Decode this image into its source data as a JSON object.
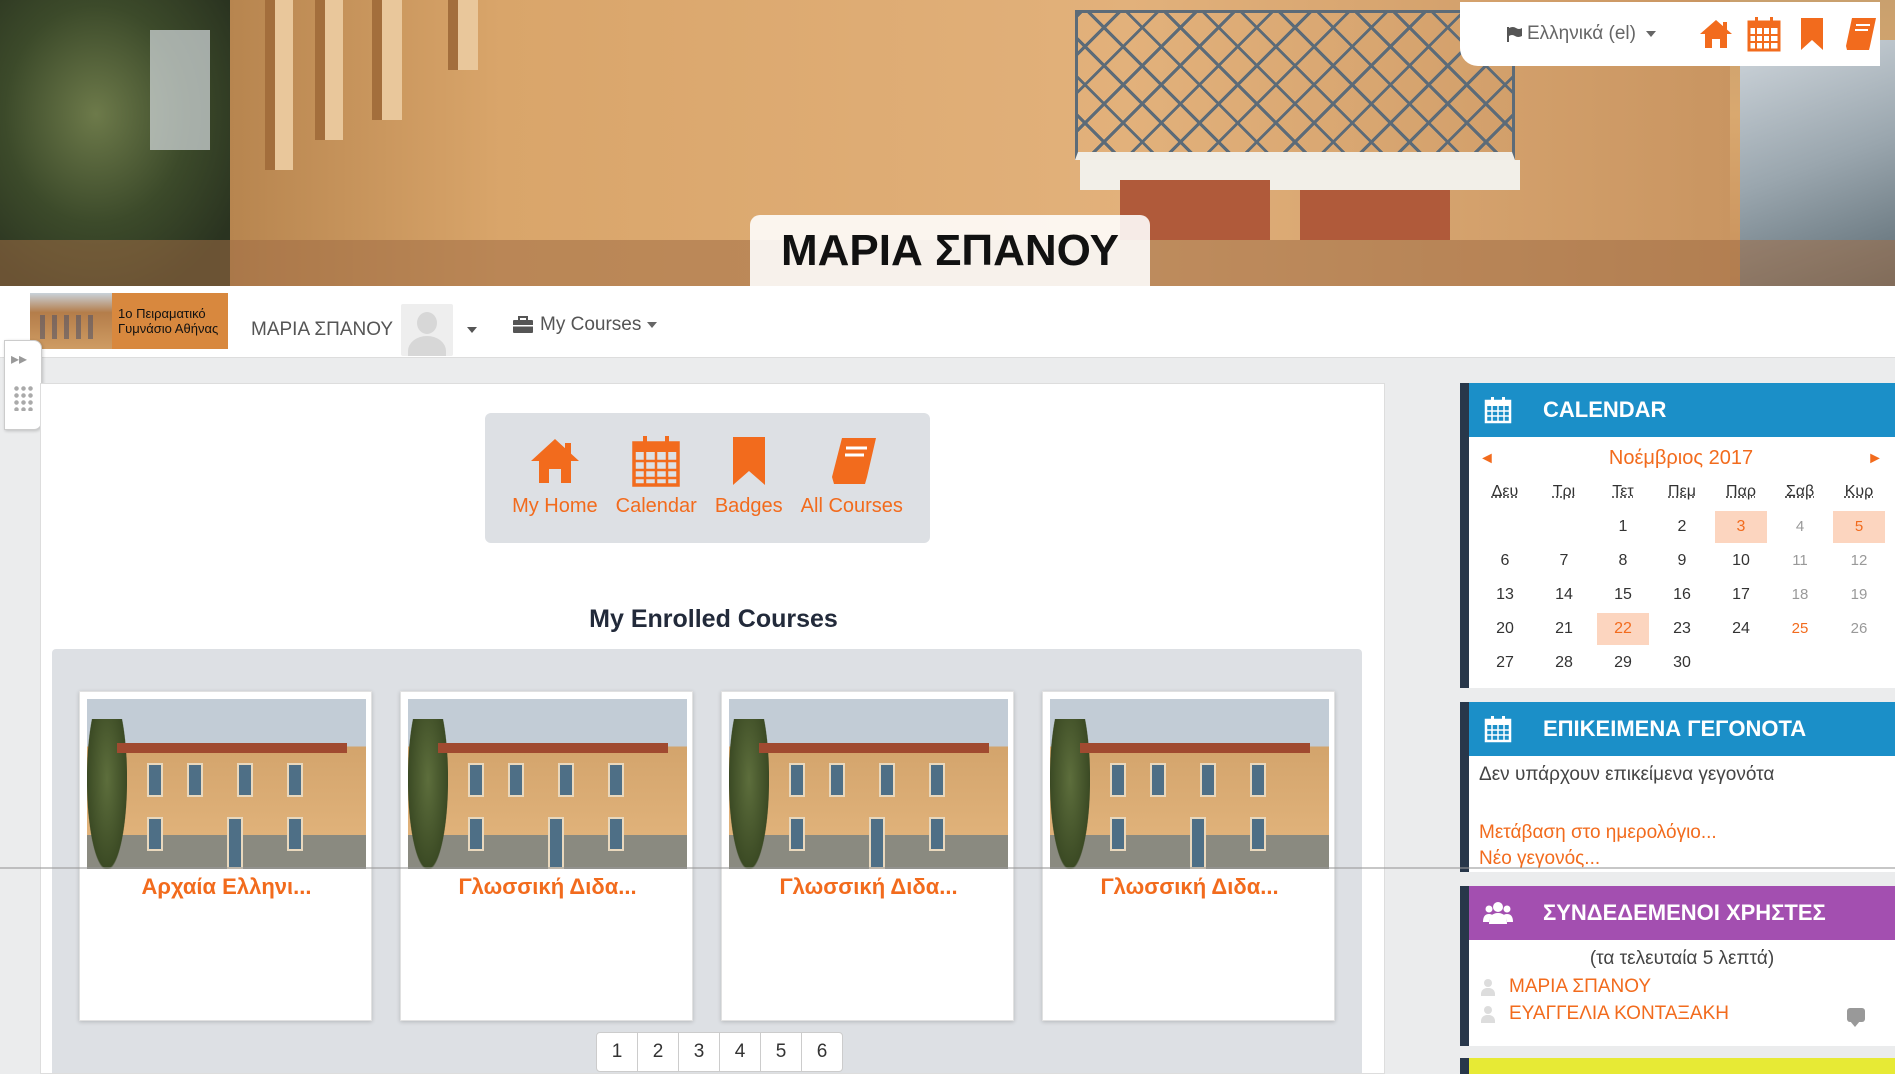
{
  "header": {
    "banner_title": "ΜΑΡΙΑ ΣΠΑΝΟΥ",
    "language": "Ελληνικά (el)",
    "top_icons": [
      "home-icon",
      "calendar-icon",
      "bookmark-icon",
      "book-icon"
    ]
  },
  "navbar": {
    "logo_text_line1": "1ο Πειραματικό",
    "logo_text_line2": "Γυμνάσιο Αθήνας",
    "user_name": "ΜΑΡΙΑ ΣΠΑΝΟΥ",
    "my_courses": "My Courses"
  },
  "quicklinks": {
    "items": [
      {
        "label": "My Home",
        "icon": "home-icon"
      },
      {
        "label": "Calendar",
        "icon": "calendar-icon"
      },
      {
        "label": "Badges",
        "icon": "bookmark-icon"
      },
      {
        "label": "All Courses",
        "icon": "book-icon"
      }
    ]
  },
  "enrolled": {
    "title": "My Enrolled Courses",
    "courses": [
      {
        "title": "Αρχαία Ελληνι..."
      },
      {
        "title": "Γλωσσική Διδα..."
      },
      {
        "title": "Γλωσσική Διδα..."
      },
      {
        "title": "Γλωσσική Διδα..."
      }
    ],
    "pages": [
      "1",
      "2",
      "3",
      "4",
      "5",
      "6"
    ]
  },
  "calendar": {
    "title": "CALENDAR",
    "month": "Νοέμβριος 2017",
    "prev": "◄",
    "next": "►",
    "day_names": [
      "Δευ",
      "Τρι",
      "Τετ",
      "Πεμ",
      "Παρ",
      "Σαβ",
      "Κυρ"
    ],
    "weeks": [
      [
        "",
        "",
        "1",
        "2",
        "3",
        "4",
        "5"
      ],
      [
        "6",
        "7",
        "8",
        "9",
        "10",
        "11",
        "12"
      ],
      [
        "13",
        "14",
        "15",
        "16",
        "17",
        "18",
        "19"
      ],
      [
        "20",
        "21",
        "22",
        "23",
        "24",
        "25",
        "26"
      ],
      [
        "27",
        "28",
        "29",
        "30",
        "",
        "",
        ""
      ]
    ],
    "event_days": [
      "3",
      "5",
      "22"
    ],
    "holiday_days": [
      "25"
    ]
  },
  "upcoming": {
    "title": "ΕΠΙΚΕΙΜΕΝΑ ΓΕΓΟΝΟΤΑ",
    "none_text": "Δεν υπάρχουν επικείμενα γεγονότα",
    "goto_calendar": "Μετάβαση στο ημερολόγιο...",
    "new_event": "Νέο γεγονός..."
  },
  "online": {
    "title": "ΣΥΝΔΕΔΕΜΕΝΟΙ ΧΡΗΣΤΕΣ",
    "subtitle": "(τα τελευταία 5 λεπτά)",
    "users": [
      "ΜΑΡΙΑ ΣΠΑΝΟΥ",
      "ΕΥΑΓΓΕΛΙΑ ΚΟΝΤΑΞΑΚΗ"
    ]
  },
  "colors": {
    "accent": "#f26b1d",
    "calendar_header": "#1b8fc8",
    "online_header": "#a34fb0",
    "block_border": "#28374a"
  }
}
